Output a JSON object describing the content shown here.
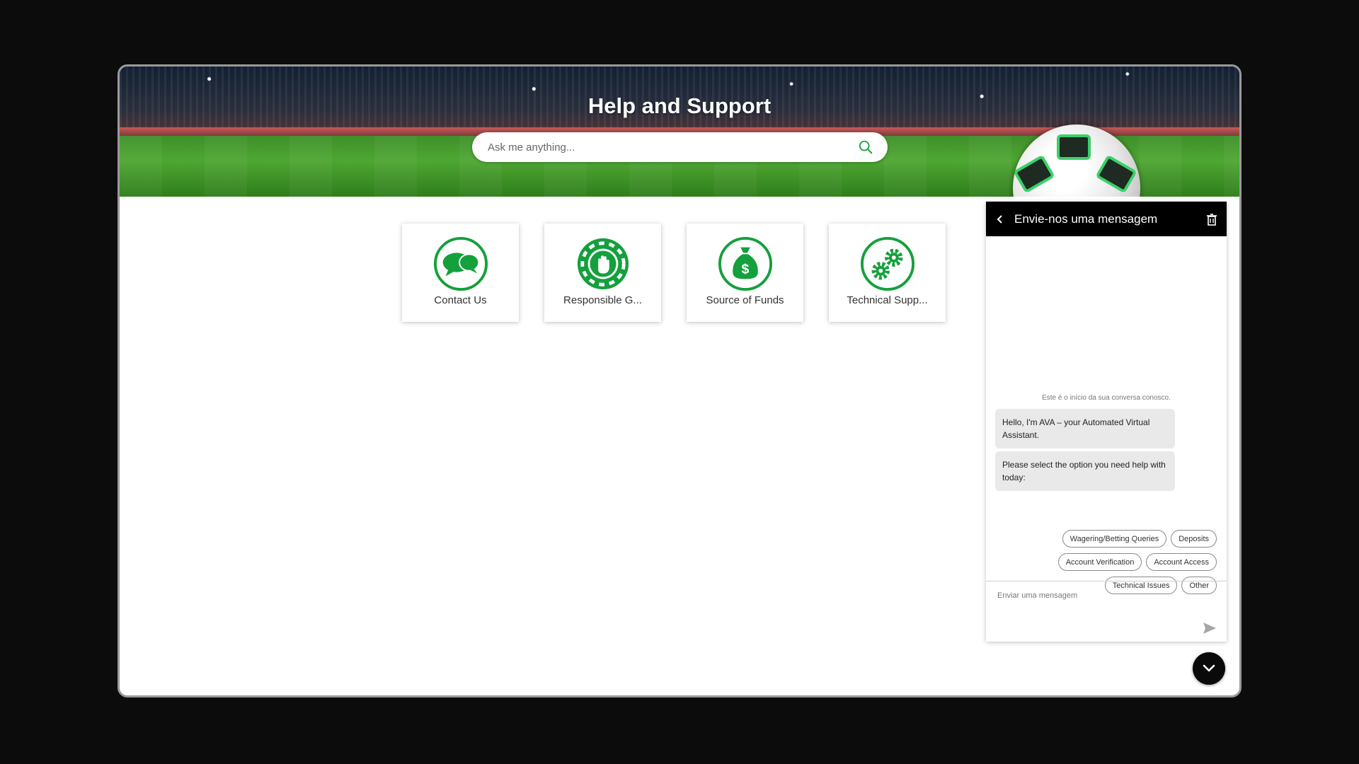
{
  "page": {
    "title": "Help and Support",
    "search_placeholder": "Ask me anything..."
  },
  "cards": [
    {
      "label": "Contact Us",
      "icon": "chat-bubbles-icon"
    },
    {
      "label": "Responsible G...",
      "icon": "hand-stop-chip-icon"
    },
    {
      "label": "Source of Funds",
      "icon": "money-bag-icon"
    },
    {
      "label": "Technical Supp...",
      "icon": "gears-icon"
    }
  ],
  "chat": {
    "header_title": "Envie-nos uma mensagem",
    "notice": "Este é o início da sua conversa conosco.",
    "messages": [
      "Hello, I'm AVA – your Automated Virtual Assistant.",
      "Please select the option you need help with today:"
    ],
    "options": [
      "Wagering/Betting Queries",
      "Deposits",
      "Account Verification",
      "Account Access",
      "Technical Issues",
      "Other"
    ],
    "input_placeholder": "Enviar uma mensagem"
  },
  "colors": {
    "brand_green": "#14a03c",
    "header_black": "#000000"
  }
}
